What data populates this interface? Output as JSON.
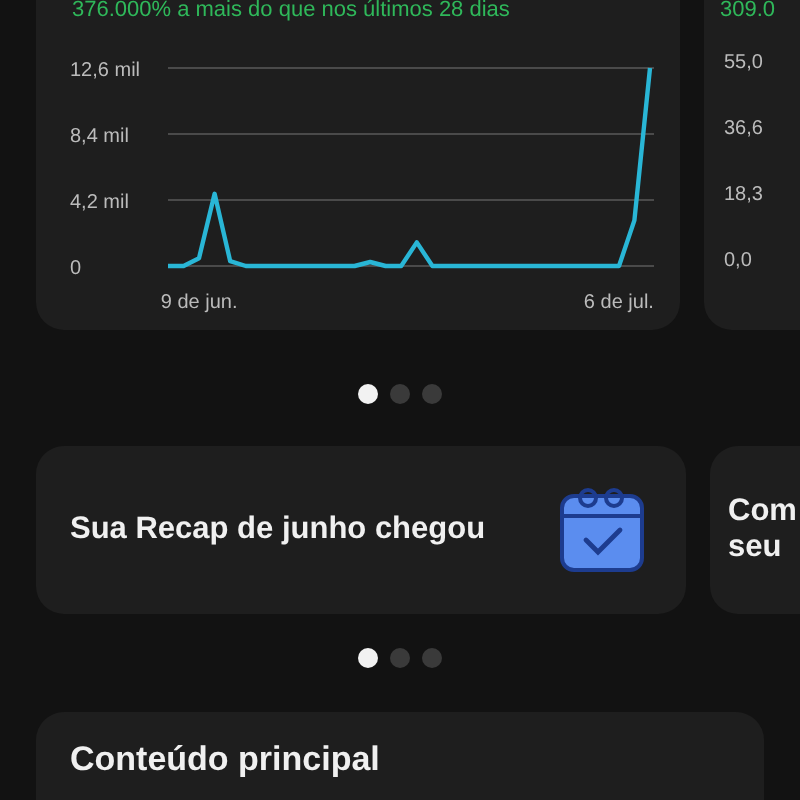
{
  "stats_card": {
    "subtitle": "376.000% a mais do que nos últimos 28 dias",
    "chart_data": {
      "type": "line",
      "categories": [
        null,
        null,
        "9 de jun.",
        null,
        null,
        null,
        null,
        null,
        null,
        null,
        null,
        null,
        null,
        null,
        null,
        null,
        null,
        null,
        null,
        null,
        null,
        null,
        null,
        null,
        null,
        null,
        null,
        null,
        null,
        "6 de jul.",
        null,
        null
      ],
      "series": [
        {
          "color": "#29b6d6",
          "values": [
            0,
            0,
            0.5,
            4.6,
            0.3,
            0,
            0,
            0,
            0,
            0,
            0,
            0,
            0,
            0.25,
            0,
            0,
            1.5,
            0,
            0,
            0,
            0,
            0,
            0,
            0,
            0,
            0,
            0,
            0,
            0,
            0,
            2.9,
            12.6
          ]
        }
      ],
      "ylim": [
        0,
        12.6
      ],
      "yticks": [
        {
          "value": 0,
          "label": "0"
        },
        {
          "value": 4.2,
          "label": "4,2 mil"
        },
        {
          "value": 8.4,
          "label": "8,4 mil"
        },
        {
          "value": 12.6,
          "label": "12,6 mil"
        }
      ]
    }
  },
  "next_stats_card": {
    "subtitle": "309.0",
    "y_labels": [
      "55,0",
      "36,6",
      "18,3",
      "0,0"
    ]
  },
  "pager_1": [
    {
      "selected": true
    },
    {
      "selected": false
    },
    {
      "selected": false
    }
  ],
  "recap_card": {
    "title": "Sua Recap de junho chegou"
  },
  "next_recap_card": {
    "title_lines": [
      "Com",
      "seu"
    ]
  },
  "pager_2": [
    {
      "selected": true
    },
    {
      "selected": false
    },
    {
      "selected": false
    }
  ],
  "main_content": {
    "title": "Conteúdo principal"
  }
}
